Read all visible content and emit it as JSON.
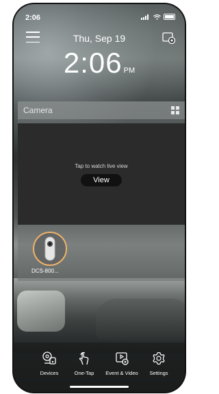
{
  "status_bar": {
    "time": "2:06"
  },
  "header": {
    "date": "Thu, Sep 19",
    "time": "2:06",
    "ampm": "PM"
  },
  "camera_panel": {
    "title": "Camera",
    "live_hint": "Tap to watch live view",
    "view_label": "View",
    "device": {
      "name": "DCS-800...",
      "icon": "camera-device-icon",
      "accent": "#f0b46a"
    }
  },
  "tabbar": {
    "items": [
      {
        "label": "Devices",
        "icon": "devices-icon"
      },
      {
        "label": "One-Tap",
        "icon": "one-tap-icon"
      },
      {
        "label": "Event & Video",
        "icon": "event-video-icon"
      },
      {
        "label": "Settings",
        "icon": "settings-icon"
      }
    ]
  }
}
